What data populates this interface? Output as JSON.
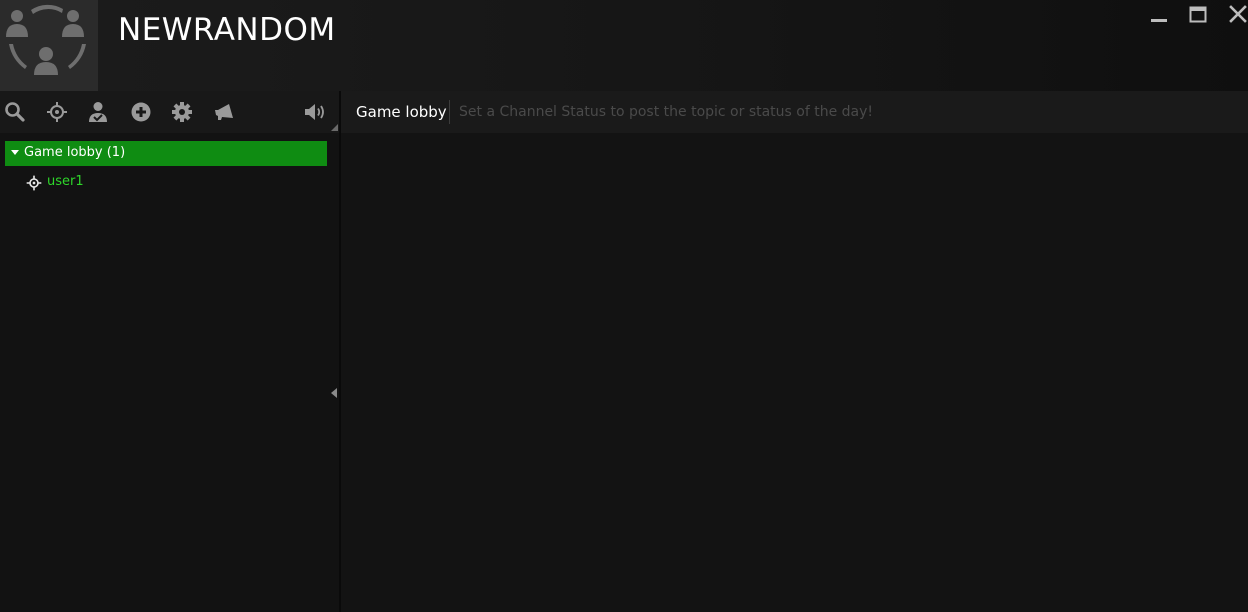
{
  "app": {
    "title": "NEWRANDOM",
    "logo_icon": "group-people-icon"
  },
  "window_controls": {
    "minimize_icon": "minimize-icon",
    "maximize_icon": "maximize-icon",
    "close_icon": "close-icon"
  },
  "toolbar": {
    "icons": [
      "search-icon",
      "crosshair-icon",
      "user-icon",
      "add-circle-icon",
      "gear-icon",
      "megaphone-icon",
      "speaker-icon"
    ]
  },
  "channel_tree": {
    "group": {
      "label": "Game lobby (1)",
      "expanded": true
    },
    "users": [
      {
        "name": "user1",
        "icon": "crosshair-icon"
      }
    ]
  },
  "channel_header": {
    "name": "Game lobby",
    "status_placeholder": "Set a Channel Status to post the topic or status of the day!",
    "status_value": ""
  },
  "colors": {
    "accent_green": "#0f8c12",
    "user_green": "#2ed62a",
    "background": "#131313"
  }
}
